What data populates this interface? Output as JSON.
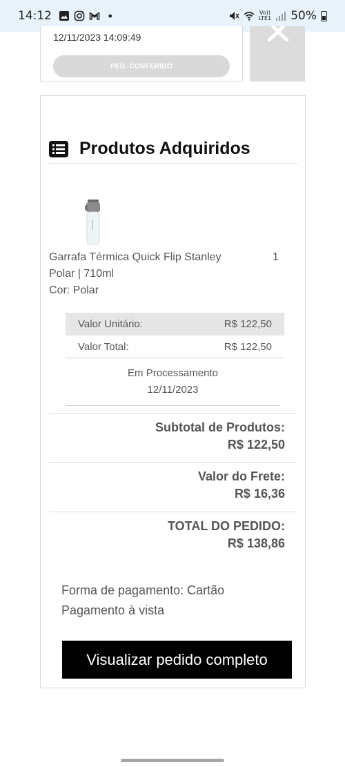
{
  "status_bar": {
    "time": "14:12",
    "dot": "•",
    "volte_top": "Vo))",
    "volte_bottom": "LTE1",
    "battery": "50%"
  },
  "previous_order": {
    "datetime": "12/11/2023 14:09:49",
    "status_button": "PED. CONFERIDO"
  },
  "products_section": {
    "title": "Produtos Adquiridos",
    "product": {
      "name": "Garrafa Térmica Quick Flip Stanley Polar | 710ml",
      "quantity": "1",
      "color": "Cor: Polar",
      "unit_price_label": "Valor Unitário:",
      "unit_price": "R$ 122,50",
      "total_price_label": "Valor Total:",
      "total_price": "R$ 122,50",
      "status": "Em Processamento",
      "status_date": "12/11/2023"
    }
  },
  "totals": {
    "subtotal_label": "Subtotal de Produtos:",
    "subtotal_value": "R$ 122,50",
    "shipping_label": "Valor do Frete:",
    "shipping_value": "R$ 16,36",
    "order_total_label": "TOTAL DO PEDIDO:",
    "order_total_value": "R$ 138,86"
  },
  "payment": {
    "method": "Forma de pagamento: Cartão",
    "terms": "Pagamento à vista"
  },
  "actions": {
    "view_full_order": "Visualizar pedido completo"
  }
}
